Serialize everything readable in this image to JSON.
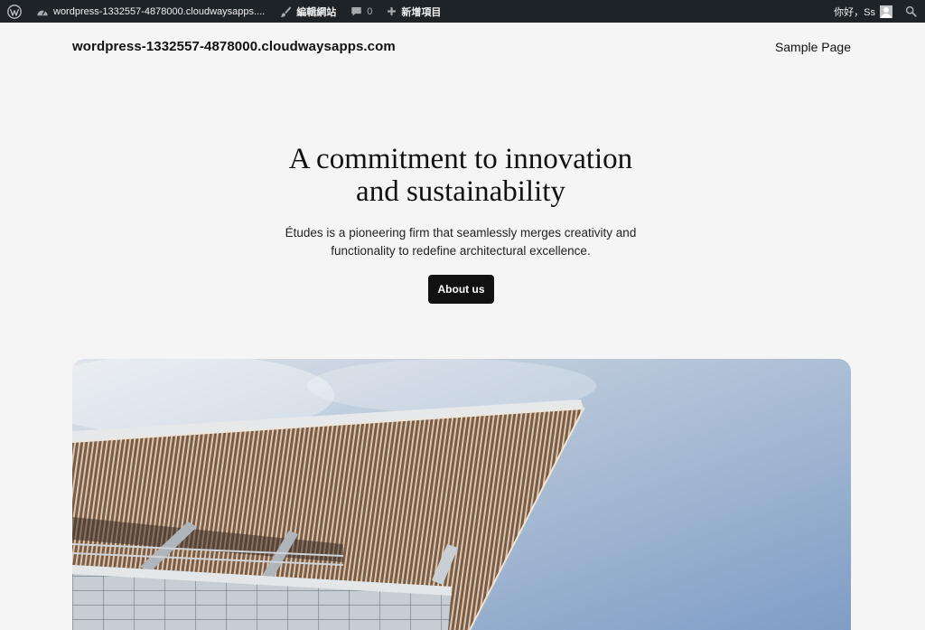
{
  "adminbar": {
    "site_name": "wordpress-1332557-4878000.cloudwaysapps....",
    "edit_site": "編輯網站",
    "comments_count": "0",
    "new_item": "新增項目",
    "greeting": "你好，Ss",
    "icons": [
      "wordpress-logo-icon",
      "dashboard-icon",
      "edit-brush-icon",
      "comment-icon",
      "plus-icon",
      "avatar",
      "search-icon"
    ]
  },
  "header": {
    "site_title": "wordpress-1332557-4878000.cloudwaysapps.com",
    "nav": [
      "Sample Page"
    ]
  },
  "hero": {
    "heading_line1": "A commitment to innovation",
    "heading_line2": "and sustainability",
    "text_line1": "Études is a pioneering firm that seamlessly merges creativity and",
    "text_line2": "functionality to redefine architectural excellence.",
    "button": "About us"
  },
  "colors": {
    "adminbar_bg": "#1d2327",
    "page_bg": "#f5f5f5",
    "button_bg": "#111111",
    "sky": "#93aed0"
  }
}
